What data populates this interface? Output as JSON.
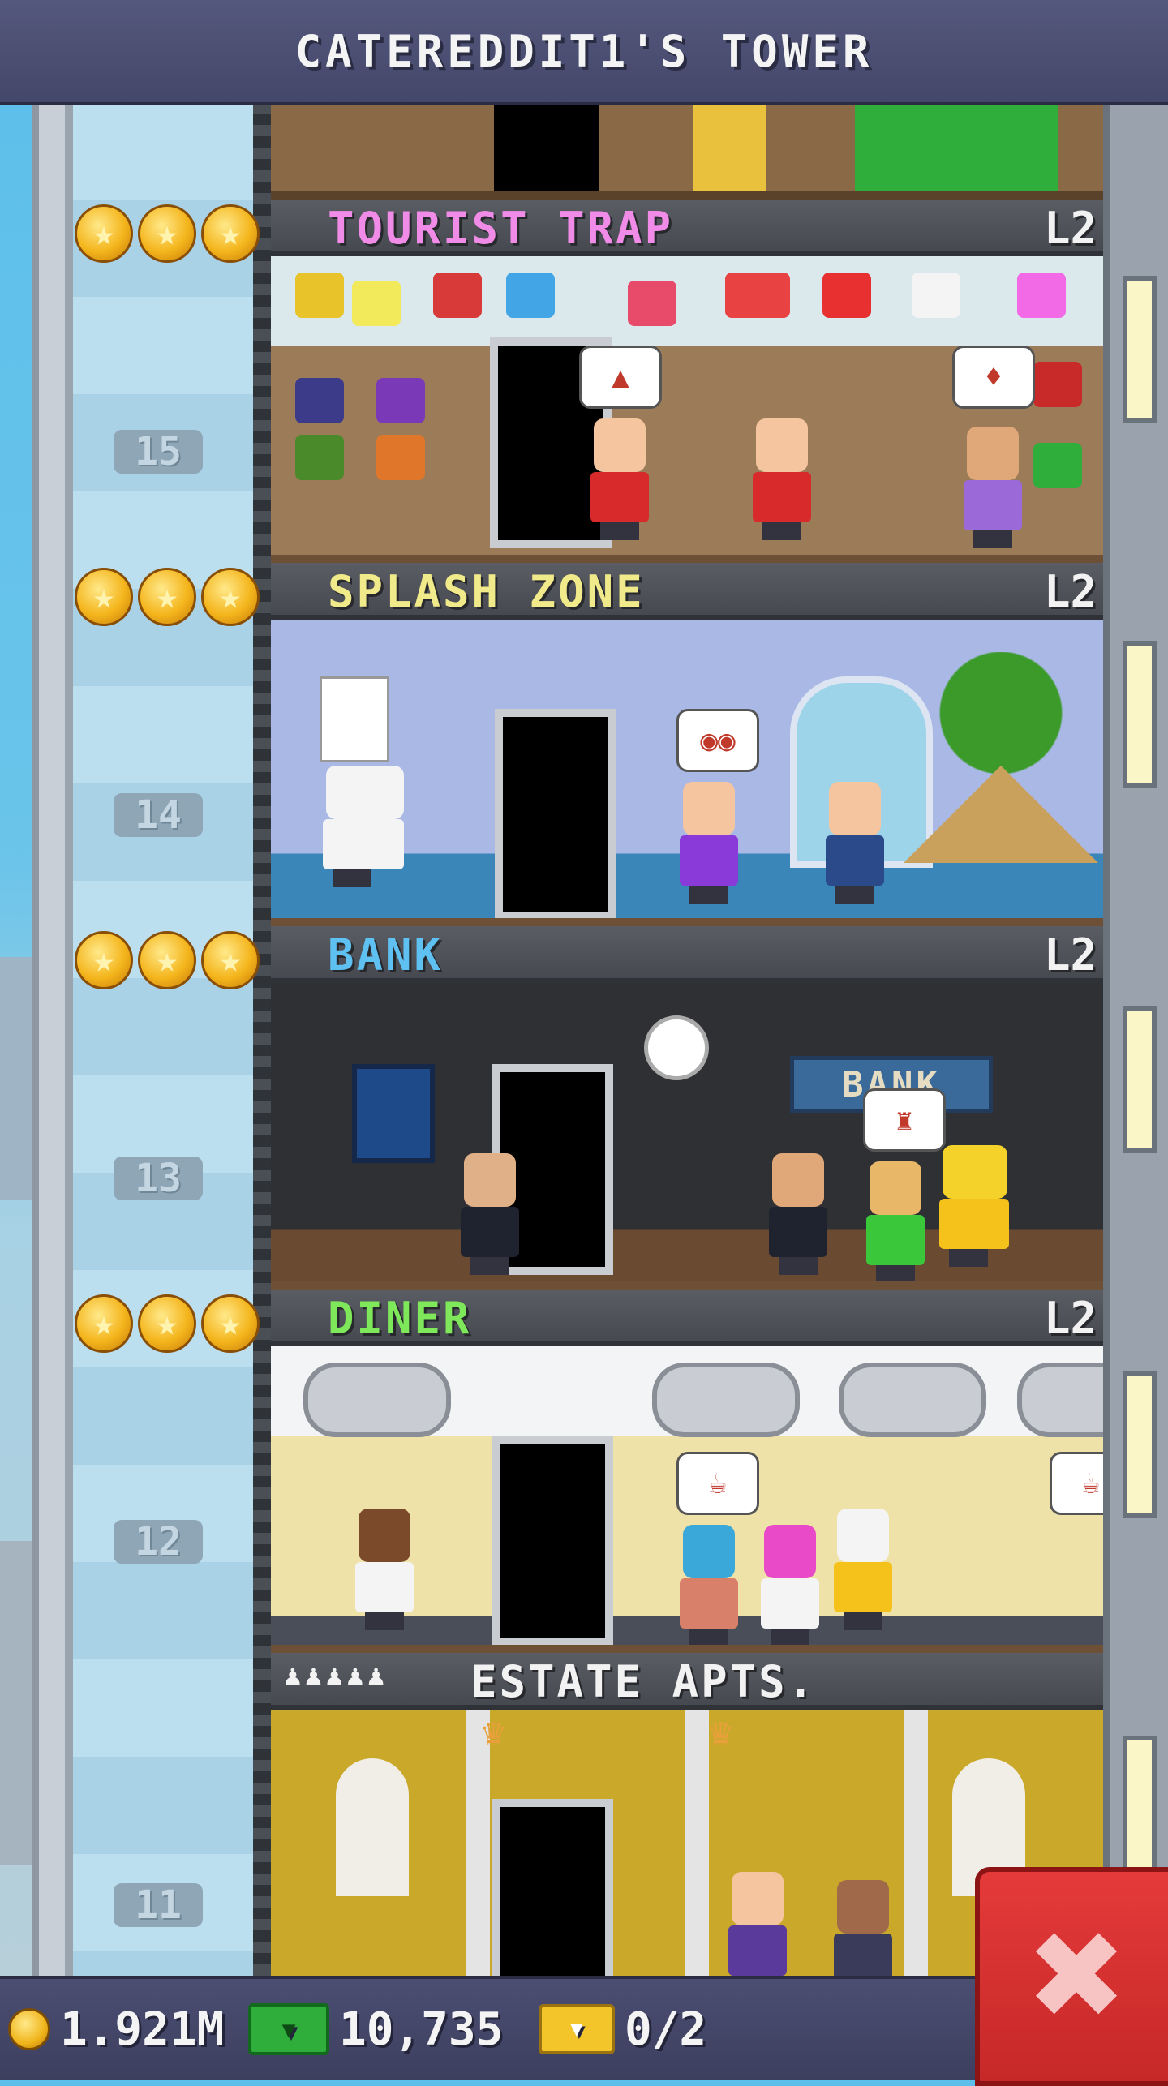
{
  "header": {
    "title": "CATEREDDIT1'S TOWER"
  },
  "floors": [
    {
      "name": "TOURIST TRAP",
      "level": "L2",
      "number": "15",
      "stars": 3,
      "name_color": "#f08ce8"
    },
    {
      "name": "SPLASH ZONE",
      "level": "L2",
      "number": "14",
      "stars": 3,
      "name_color": "#f1ea8a"
    },
    {
      "name": "BANK",
      "level": "L2",
      "number": "13",
      "stars": 3,
      "name_color": "#5fc0f2"
    },
    {
      "name": "DINER",
      "level": "L2",
      "number": "12",
      "stars": 3,
      "name_color": "#7ee85a"
    },
    {
      "name": "ESTATE APTS.",
      "level": "",
      "number": "11",
      "stars": 0,
      "name_color": "#f2f2f2"
    }
  ],
  "bank_sign": "BANK",
  "status": {
    "coins": "1.921M",
    "bux": "10,735",
    "tickets": "0/2"
  },
  "icons": {
    "coin": "coin-icon",
    "bux": "bux-icon",
    "ticket": "vip-ticket-icon",
    "close": "close-icon",
    "star": "star-icon"
  }
}
